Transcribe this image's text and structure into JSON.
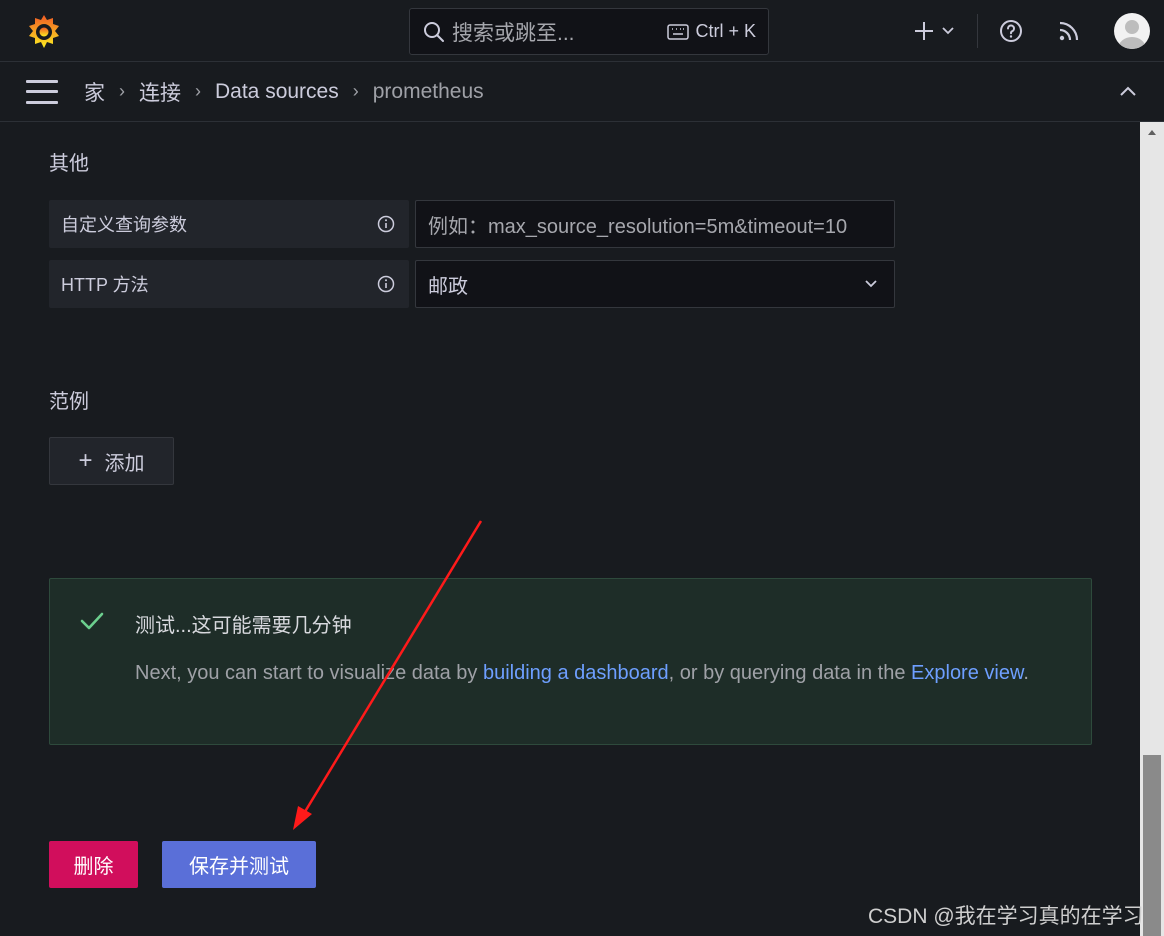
{
  "search": {
    "placeholder": "搜索或跳至...",
    "shortcut": "Ctrl + K"
  },
  "breadcrumb": [
    "家",
    "连接",
    "Data sources",
    "prometheus"
  ],
  "misc_section": {
    "title": "其他",
    "custom_query_label": "自定义查询参数",
    "custom_query_placeholder": "例如：max_source_resolution=5m&timeout=10",
    "http_method_label": "HTTP 方法",
    "http_method_value": "邮政"
  },
  "examples_section": {
    "title": "范例",
    "add_label": "添加"
  },
  "alert": {
    "title": "测试...这可能需要几分钟",
    "body_prefix": "Next, you can start to visualize data by ",
    "link_dashboard": "building a dashboard",
    "body_middle": ", or by querying data in the ",
    "link_explore": "Explore view",
    "body_suffix": "."
  },
  "actions": {
    "delete": "删除",
    "save_test": "保存并测试"
  },
  "watermark": "CSDN @我在学习真的在学习",
  "colors": {
    "accent_blue": "#5a6fd8",
    "danger": "#d10e5c",
    "success": "#6ccf8e",
    "link": "#6e9fff"
  }
}
